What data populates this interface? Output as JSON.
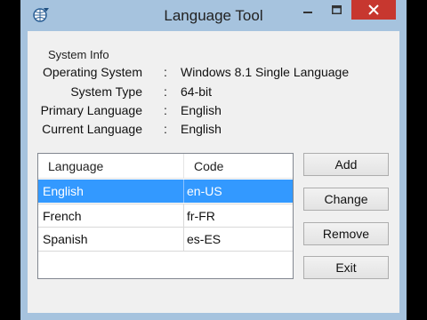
{
  "window": {
    "title": "Language Tool"
  },
  "system_info": {
    "group_title": "System Info",
    "rows": [
      {
        "label": "Operating System",
        "separator": ":",
        "value": "Windows 8.1 Single Language"
      },
      {
        "label": "System Type",
        "separator": ":",
        "value": "64-bit"
      },
      {
        "label": "Primary Language",
        "separator": ":",
        "value": "English"
      },
      {
        "label": "Current Language",
        "separator": ":",
        "value": "English"
      }
    ]
  },
  "language_list": {
    "columns": [
      "Language",
      "Code"
    ],
    "rows": [
      {
        "language": "English",
        "code": "en-US",
        "selected": true
      },
      {
        "language": "French",
        "code": "fr-FR",
        "selected": false
      },
      {
        "language": "Spanish",
        "code": "es-ES",
        "selected": false
      }
    ]
  },
  "buttons": {
    "add": "Add",
    "change": "Change",
    "remove": "Remove",
    "exit": "Exit"
  },
  "colors": {
    "frame": "#a6c3de",
    "close": "#c7372f",
    "selection": "#3399ff"
  },
  "icons": {
    "app": "globe-arrows-icon",
    "minimize": "minimize-icon",
    "maximize": "maximize-icon",
    "close": "close-icon"
  }
}
